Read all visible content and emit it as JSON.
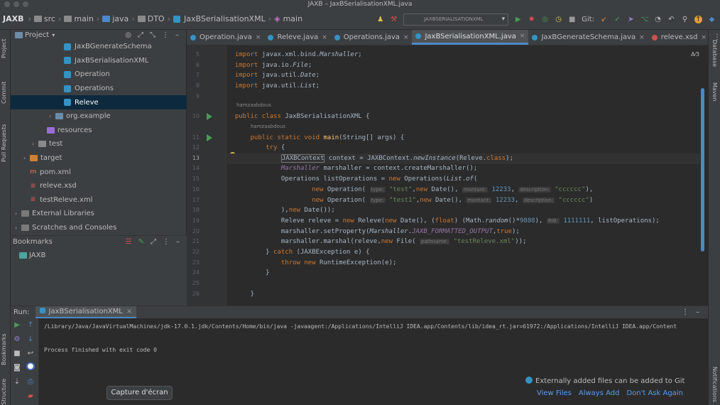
{
  "window": {
    "title": "JAXB – JaxBSerialisationXML.java"
  },
  "breadcrumbs": [
    "JAXB",
    "src",
    "main",
    "java",
    "DTO",
    "JaxBSerialisationXML",
    "main"
  ],
  "toolbar": {
    "run_config": "JAXBSERIALISATIONXML",
    "git_label": "Git:"
  },
  "left_strip": [
    "Project",
    "Commit",
    "Pull Requests"
  ],
  "left_strip_bottom": [
    "Bookmarks",
    "Structure"
  ],
  "right_strip": [
    "Database",
    "Maven"
  ],
  "right_strip_bottom": [
    "Notifications"
  ],
  "project_panel": {
    "title": "Project",
    "tree": [
      {
        "label": "JaxBGenerateSchema",
        "indent": 4,
        "kind": "class"
      },
      {
        "label": "JaxBSerialisationXML",
        "indent": 4,
        "kind": "class"
      },
      {
        "label": "Operation",
        "indent": 4,
        "kind": "class"
      },
      {
        "label": "Operations",
        "indent": 4,
        "kind": "class"
      },
      {
        "label": "Releve",
        "indent": 4,
        "kind": "class",
        "selected": true
      },
      {
        "label": "org.example",
        "indent": 3,
        "kind": "package",
        "chevron": "›"
      },
      {
        "label": "resources",
        "indent": 2,
        "kind": "resources"
      },
      {
        "label": "test",
        "indent": 1,
        "kind": "folder",
        "chevron": "›"
      },
      {
        "label": "target",
        "indent": 0,
        "kind": "folder-orange",
        "chevron": "›"
      },
      {
        "label": "pom.xml",
        "indent": 0,
        "kind": "maven"
      },
      {
        "label": "releve.xsd",
        "indent": 0,
        "kind": "xsd"
      },
      {
        "label": "testReleve.xml",
        "indent": 0,
        "kind": "xml"
      },
      {
        "label": "External Libraries",
        "indent": -1,
        "kind": "lib",
        "chevron": "›"
      },
      {
        "label": "Scratches and Consoles",
        "indent": -1,
        "kind": "scratch",
        "chevron": "›"
      }
    ]
  },
  "bookmarks_panel": {
    "title": "Bookmarks",
    "items": [
      "JAXB"
    ]
  },
  "tabs": [
    {
      "label": "Operation.java",
      "active": false
    },
    {
      "label": "Releve.java",
      "active": false
    },
    {
      "label": "Operations.java",
      "active": false
    },
    {
      "label": "JaxBSerialisationXML.java",
      "active": true
    },
    {
      "label": "JaxBGenerateSchema.java",
      "active": false
    },
    {
      "label": "releve.xsd",
      "active": false
    }
  ],
  "editor": {
    "inspection": "A⁄3",
    "authors": [
      "hamzaabdous",
      "hamzaabdous"
    ],
    "line_numbers": [
      "5",
      "6",
      "7",
      "8",
      "9",
      "10",
      "11",
      "12",
      "13",
      "14",
      "15",
      "16",
      "17",
      "18",
      "19",
      "20",
      "21",
      "22",
      "23",
      "24",
      "25",
      "26"
    ],
    "current_line": "13"
  },
  "run_panel": {
    "label": "Run:",
    "tab": "JaxBSerialisationXML",
    "command": "/Library/Java/JavaVirtualMachines/jdk-17.0.1.jdk/Contents/Home/bin/java -javaagent:/Applications/IntelliJ IDEA.app/Contents/lib/idea_rt.jar=61972:/Applications/IntelliJ IDEA.app/Content",
    "exit": "Process finished with exit code 0"
  },
  "notification": {
    "text": "Externally added files can be added to Git",
    "actions": [
      "View Files",
      "Always Add",
      "Don't Ask Again"
    ]
  },
  "tooltip": "Capture d'écran",
  "colors": {
    "accent": "#4a88c7",
    "run": "#499c54",
    "keyword": "#cc7832",
    "string": "#6a8759",
    "number": "#6897bb"
  }
}
